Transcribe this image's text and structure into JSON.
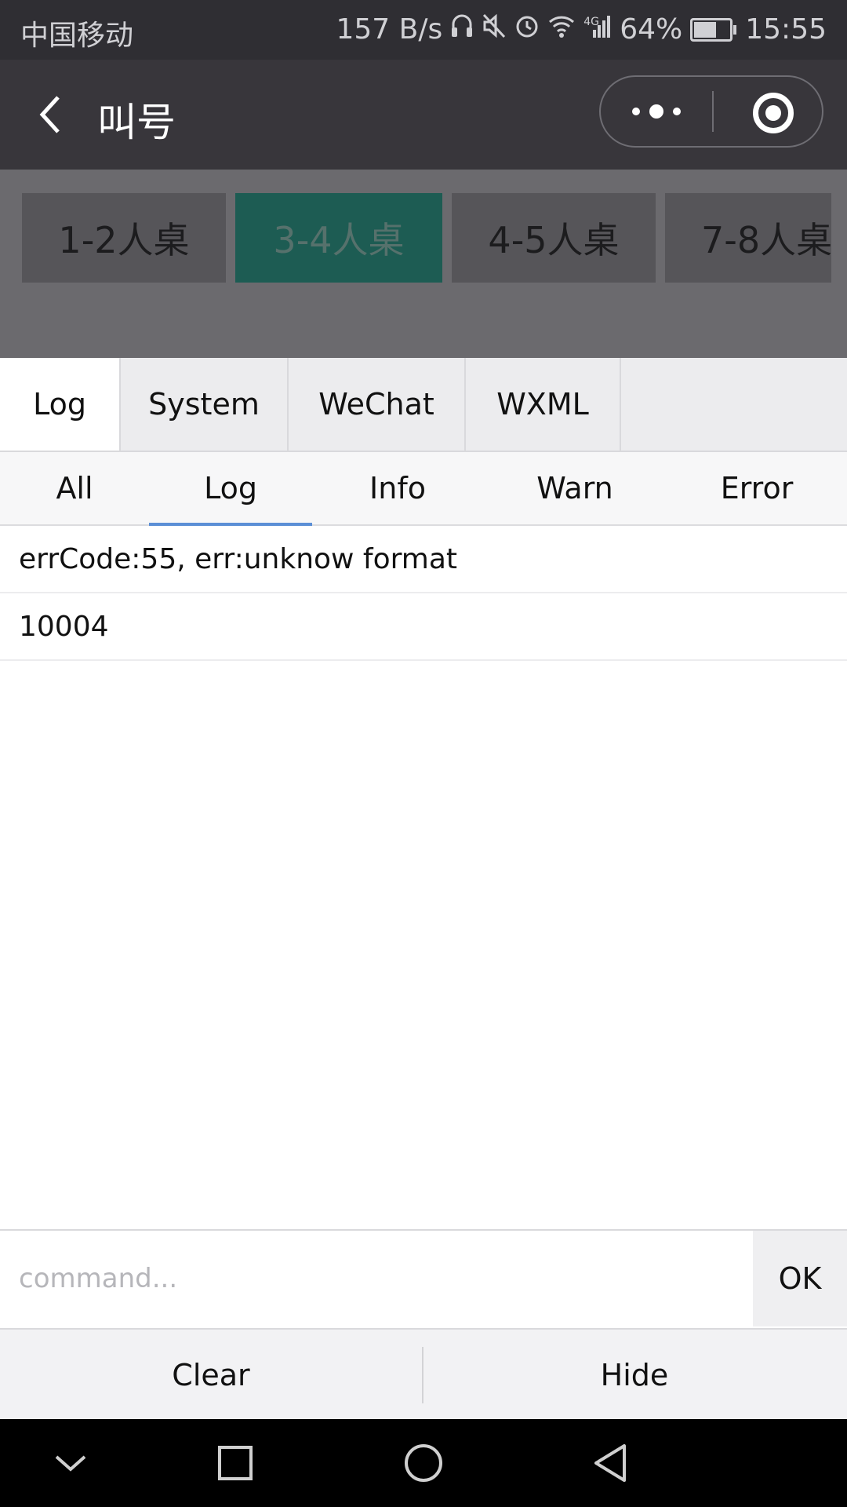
{
  "status_bar": {
    "carrier": "中国移动",
    "speed": "157 B/s",
    "network": "4G",
    "battery": "64%",
    "battery_level": 0.64,
    "time": "15:55"
  },
  "nav": {
    "title": "叫号"
  },
  "table_tabs": [
    {
      "label": "1-2人桌"
    },
    {
      "label": "3-4人桌"
    },
    {
      "label": "4-5人桌"
    },
    {
      "label": "7-8人桌"
    }
  ],
  "console": {
    "tabs": [
      "Log",
      "System",
      "WeChat",
      "WXML"
    ],
    "filters": [
      "All",
      "Log",
      "Info",
      "Warn",
      "Error"
    ],
    "logs": [
      "errCode:55, err:unknow format",
      "10004"
    ],
    "command_placeholder": "command...",
    "ok_label": "OK",
    "clear_label": "Clear",
    "hide_label": "Hide"
  }
}
